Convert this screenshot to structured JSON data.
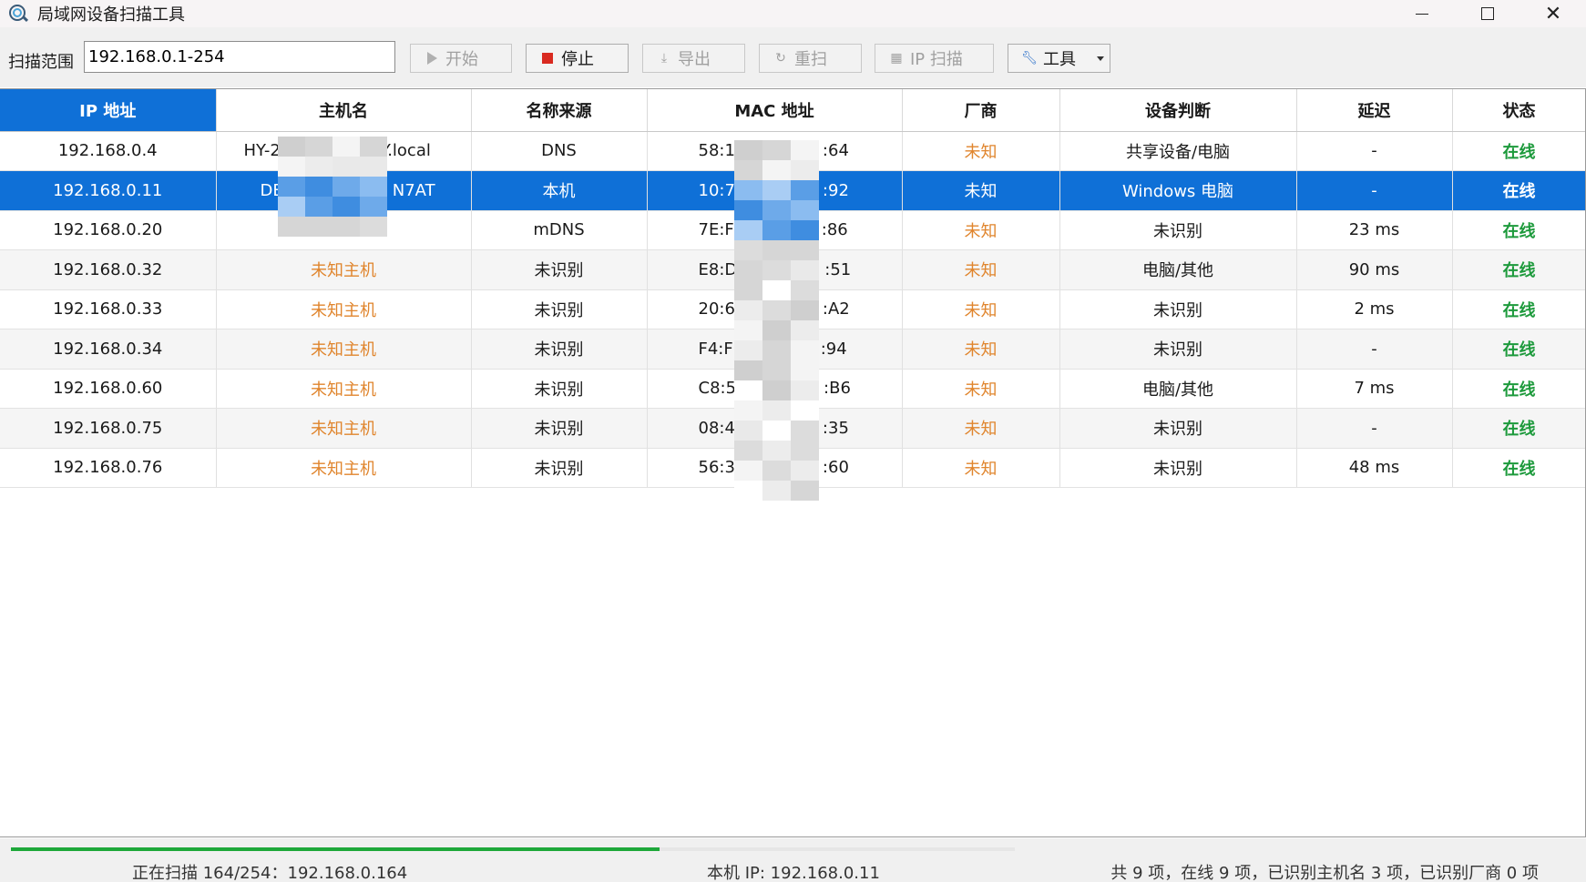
{
  "window": {
    "title": "局域网设备扫描工具",
    "minimize_glyph": "─",
    "close_glyph": "✕"
  },
  "toolbar": {
    "scan_range_label": "扫描范围",
    "scan_range_value": "192.168.0.1-254",
    "buttons": {
      "start": "开始",
      "stop": "停止",
      "export": "导出",
      "rescan": "重扫",
      "ip_scan": "IP 扫描",
      "tools": "工具"
    },
    "icons": {
      "start": "play-icon",
      "stop": "stop-icon",
      "export": "export-icon",
      "rescan": "refresh-icon",
      "ip_scan": "grid-icon",
      "tools": "wrench-icon"
    }
  },
  "table": {
    "columns": [
      "IP 地址",
      "主机名",
      "名称来源",
      "MAC 地址",
      "厂商",
      "设备判断",
      "延迟",
      "状态"
    ],
    "rows": [
      [
        "192.168.0.4",
        "HY-2",
        "DNS",
        "58:1",
        "未知",
        "共享设备/电脑",
        "-",
        "在线"
      ],
      [
        "192.168.0.11",
        "DE",
        "本机",
        "10:7",
        "未知",
        "Windows 电脑",
        "-",
        "在线"
      ],
      [
        "192.168.0.20",
        "",
        "mDNS",
        "7E:F",
        "未知",
        "未识别",
        "23 ms",
        "在线"
      ],
      [
        "192.168.0.32",
        "未知主机",
        "未识别",
        "E8:D",
        "未知",
        "电脑/其他",
        "90 ms",
        "在线"
      ],
      [
        "192.168.0.33",
        "未知主机",
        "未识别",
        "20:6",
        "未知",
        "未识别",
        "2 ms",
        "在线"
      ],
      [
        "192.168.0.34",
        "未知主机",
        "未识别",
        "F4:F",
        "未知",
        "未识别",
        "-",
        "在线"
      ],
      [
        "192.168.0.60",
        "未知主机",
        "未识别",
        "C8:5",
        "未知",
        "电脑/其他",
        "7 ms",
        "在线"
      ],
      [
        "192.168.0.75",
        "未知主机",
        "未识别",
        "08:4",
        "未知",
        "未识别",
        "-",
        "在线"
      ],
      [
        "192.168.0.76",
        "未知主机",
        "未识别",
        "56:3",
        "未知",
        "未识别",
        "48 ms",
        "在线"
      ]
    ],
    "host_suffix": [
      "Y.local",
      "N7AT",
      "",
      "",
      "",
      "",
      "",
      "",
      ""
    ],
    "mac_suffix": [
      ":64",
      ":92",
      ":86",
      ":51",
      ":A2",
      ":94",
      ":B6",
      ":35",
      ":60"
    ],
    "selected_row_index": 1,
    "colors": {
      "selection": "#0f70d7",
      "unknown_orange": "#e0852d",
      "online_green": "#1d9a3c"
    }
  },
  "status": {
    "scanning_text": "正在扫描 164/254：192.168.0.164",
    "local_ip_text": "本机 IP: 192.168.0.11",
    "summary_text": "共 9 项，在线 9 项，已识别主机名 3 项，已识别厂商 0 项",
    "progress_fraction": 0.6457
  }
}
